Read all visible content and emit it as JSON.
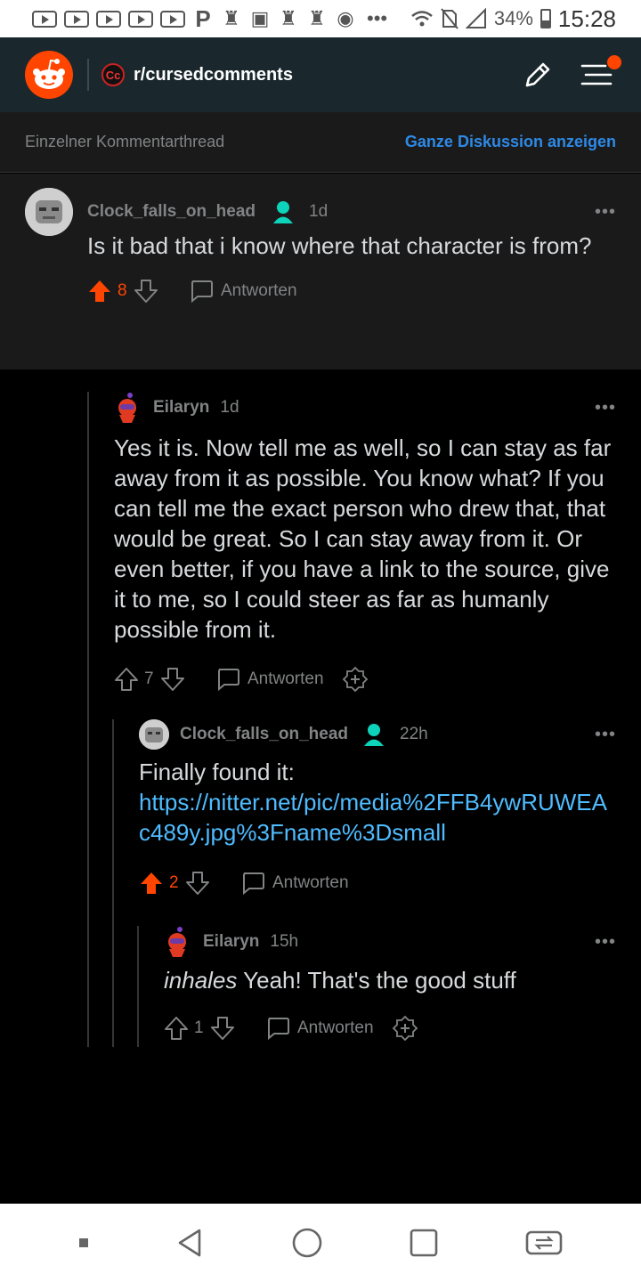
{
  "statusbar": {
    "battery": "34%",
    "time": "15:28",
    "icons": [
      "youtube-icon",
      "youtube-icon",
      "youtube-icon",
      "youtube-icon",
      "youtube-icon",
      "pinterest-icon",
      "app-icon",
      "gallery-icon",
      "app-icon",
      "app-icon",
      "spotify-icon",
      "more-icon",
      "wifi-icon",
      "no-sim-icon",
      "signal-icon",
      "battery-icon"
    ],
    "more": "•••"
  },
  "header": {
    "subreddit_icon_text": "Cc",
    "subreddit": "r/cursedcomments"
  },
  "threadbar": {
    "single_label": "Einzelner Kommentarthread",
    "full_label": "Ganze Diskussion anzeigen"
  },
  "comments": [
    {
      "user": "Clock_falls_on_head",
      "time": "1d",
      "body": "Is it bad that i know where that character is from?",
      "votes": "8",
      "upvoted": true,
      "reply_label": "Antworten",
      "more": "•••"
    },
    {
      "user": "Eilaryn",
      "time": "1d",
      "body": "Yes it is. Now tell me as well, so I can stay as far away from it as possible. You know what? If you can tell me the exact person who drew that, that would be great. So I can stay away from it. Or even better, if you have a link to the source, give it to me, so I could steer as far as humanly possible from it.",
      "votes": "7",
      "upvoted": false,
      "reply_label": "Antworten",
      "more": "•••"
    },
    {
      "user": "Clock_falls_on_head",
      "time": "22h",
      "body": "Finally found it:",
      "link": "https://nitter.net/pic/media%2FFB4ywRUWEAc489y.jpg%3Fname%3Dsmall",
      "votes": "2",
      "upvoted": true,
      "reply_label": "Antworten",
      "more": "•••"
    },
    {
      "user": "Eilaryn",
      "time": "15h",
      "body_em": "inhales",
      "body": " Yeah! That's the good stuff",
      "votes": "1",
      "upvoted": false,
      "reply_label": "Antworten",
      "more": "•••"
    }
  ],
  "colors": {
    "accent": "#ff4500",
    "link": "#4fbcff",
    "blue": "#2e8ae6",
    "mod_badge": "#0dd3bb"
  }
}
